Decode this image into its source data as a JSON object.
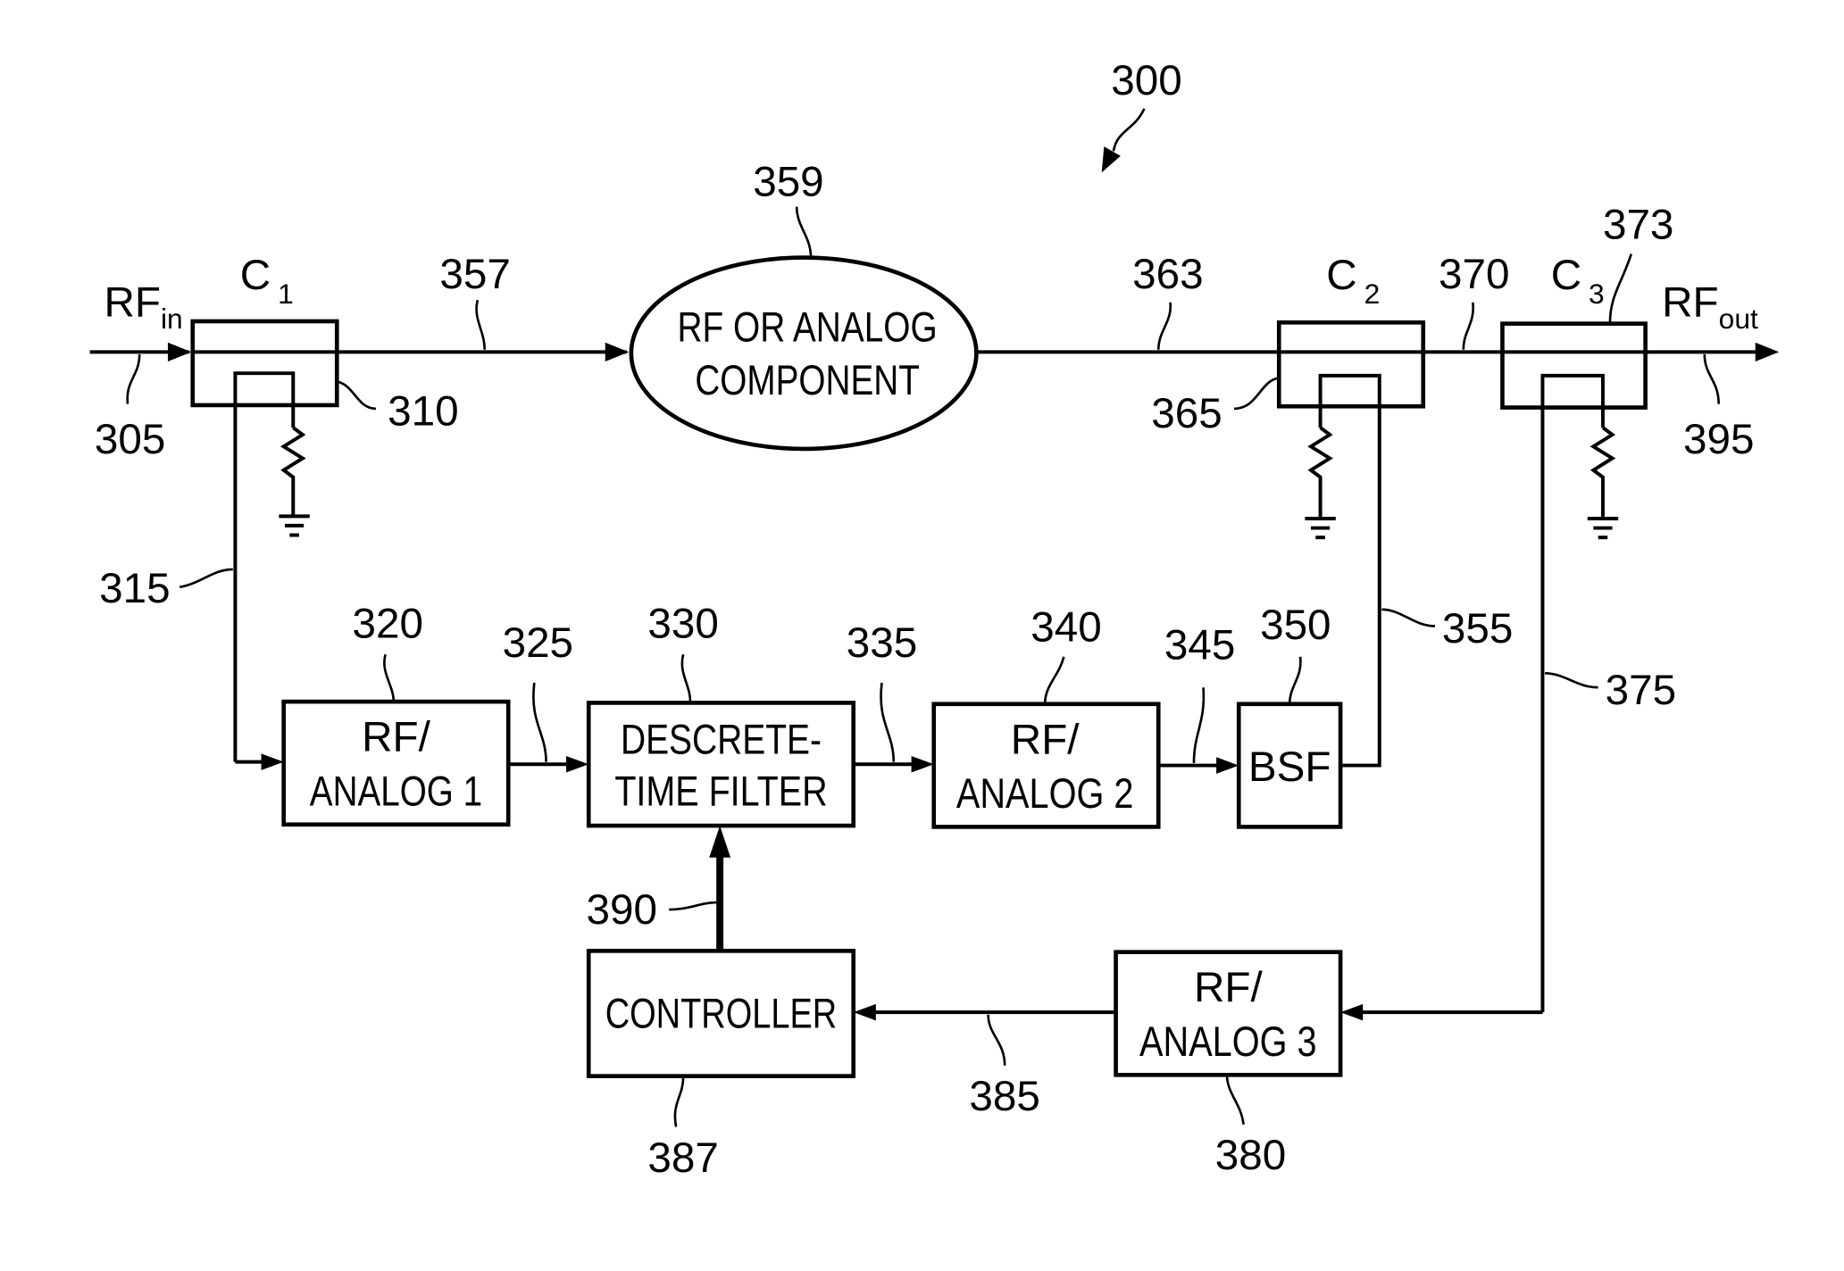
{
  "figure": {
    "ref": "300",
    "colors": {
      "ink": "#000000",
      "background": "#ffffff"
    }
  },
  "signals": {
    "rf_in": {
      "main": "RF",
      "sub": "in"
    },
    "rf_out": {
      "main": "RF",
      "sub": "out"
    }
  },
  "couplers": [
    {
      "main": "C",
      "sub": "1",
      "ref": "310"
    },
    {
      "main": "C",
      "sub": "2",
      "ref": "365"
    },
    {
      "main": "C",
      "sub": "3",
      "ref": "373"
    }
  ],
  "component": {
    "line1": "RF OR ANALOG",
    "line2": "COMPONENT",
    "ref": "359"
  },
  "blocks": {
    "rf_analog_1": {
      "line1": "RF/",
      "line2": "ANALOG 1",
      "ref": "320"
    },
    "dt_filter": {
      "line1": "DESCRETE-",
      "line2": "TIME FILTER",
      "ref": "330"
    },
    "rf_analog_2": {
      "line1": "RF/",
      "line2": "ANALOG 2",
      "ref": "340"
    },
    "bsf": {
      "line1": "BSF",
      "ref": "350"
    },
    "controller": {
      "line1": "CONTROLLER",
      "ref": "387"
    },
    "rf_analog_3": {
      "line1": "RF/",
      "line2": "ANALOG 3",
      "ref": "380"
    }
  },
  "line_refs": {
    "in": "305",
    "c1_to_comp": "357",
    "comp_to_c2": "363",
    "c2_to_c3": "370",
    "out": "395",
    "c1_tap": "315",
    "a1_to_filter": "325",
    "filter_to_a2": "335",
    "a2_to_bsf": "345",
    "bsf_to_c2": "355",
    "c3_tap": "375",
    "a3_to_ctrl": "385",
    "ctrl_to_filter": "390"
  }
}
